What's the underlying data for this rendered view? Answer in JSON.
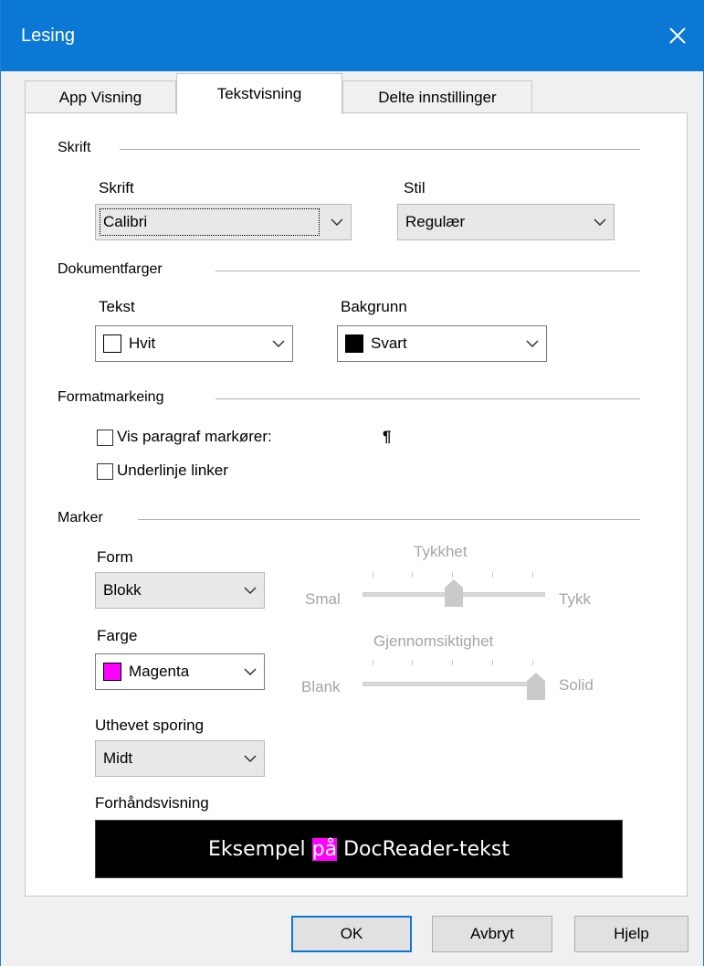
{
  "window": {
    "title": "Lesing"
  },
  "tabs": [
    {
      "label": "App Visning"
    },
    {
      "label": "Tekstvisning"
    },
    {
      "label": "Delte innstillinger"
    }
  ],
  "skrift": {
    "section": "Skrift",
    "font_label": "Skrift",
    "font_value": "Calibri",
    "style_label": "Stil",
    "style_value": "Regulær"
  },
  "dokumentfarger": {
    "section": "Dokumentfarger",
    "text_label": "Tekst",
    "text_value": "Hvit",
    "text_color": "#ffffff",
    "bg_label": "Bakgrunn",
    "bg_value": "Svart",
    "bg_color": "#000000"
  },
  "formatmarkering": {
    "section": "Formatmarkeing",
    "show_paragraph": {
      "label": "Vis paragraf markører:",
      "checked": false
    },
    "paragraph_symbol": "¶",
    "underline_links": {
      "label": "Underlinje linker",
      "checked": false
    }
  },
  "marker": {
    "section": "Marker",
    "form_label": "Form",
    "form_value": "Blokk",
    "thickness": {
      "title": "Tykkhet",
      "min_label": "Smal",
      "max_label": "Tykk",
      "value_fraction": 0.5
    },
    "color_label": "Farge",
    "color_value": "Magenta",
    "color_hex": "#ff00ff",
    "opacity": {
      "title": "Gjennomsiktighet",
      "min_label": "Blank",
      "max_label": "Solid",
      "value_fraction": 1.0
    },
    "tracking_label": "Uthevet sporing",
    "tracking_value": "Midt",
    "preview_label": "Forhåndsvisning",
    "preview_before": "Eksempel ",
    "preview_highlight": "på",
    "preview_after": " DocReader-tekst"
  },
  "buttons": {
    "ok": "OK",
    "cancel": "Avbryt",
    "help": "Hjelp"
  }
}
